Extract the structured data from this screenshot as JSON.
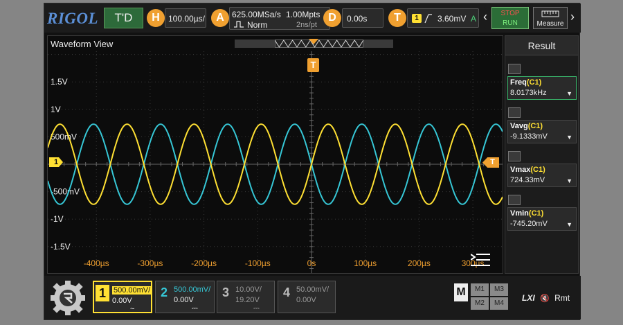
{
  "brand": "RIGOL",
  "topbar": {
    "mode": "T'D",
    "horizontal": {
      "badge": "H",
      "timebase": "100.00µs/"
    },
    "acquire": {
      "badge": "A",
      "sample_rate": "625.00MSa/s",
      "memory_depth": "1.00Mpts",
      "mode": "Norm",
      "resolution": "2ns/pt"
    },
    "delay": {
      "badge": "D",
      "value": "0.00s"
    },
    "trigger": {
      "badge": "T",
      "source": "1",
      "level": "3.60mV",
      "status": "A"
    },
    "stop_run": {
      "line1": "STOP",
      "line2": "RUN"
    },
    "measure": "Measure",
    "prev": "‹",
    "next": "›"
  },
  "waveform_view": {
    "title": "Waveform View",
    "trigger_marker": "T",
    "ch1_marker": "1",
    "trigger_level_marker": "T",
    "menu_icon": "menu-icon",
    "y_labels": [
      "1.5V",
      "1V",
      "500mV",
      "-500mV",
      "-1V",
      "-1.5V"
    ],
    "x_labels": [
      "-400µs",
      "-300µs",
      "-200µs",
      "-100µs",
      "0s",
      "100µs",
      "200µs",
      "300µs"
    ]
  },
  "result_panel": {
    "title": "Result",
    "items": [
      {
        "name": "Freq",
        "source": "(C1)",
        "value": "8.0173kHz",
        "selected": true
      },
      {
        "name": "Vavg",
        "source": "(C1)",
        "value": "-9.1333mV",
        "selected": false
      },
      {
        "name": "Vmax",
        "source": "(C1)",
        "value": "724.33mV",
        "selected": false
      },
      {
        "name": "Vmin",
        "source": "(C1)",
        "value": "-745.20mV",
        "selected": false
      }
    ]
  },
  "channels": [
    {
      "num": "1",
      "scale": "500.00mV/",
      "offset": "0.00V",
      "coupling": "~",
      "color": "#ffe033",
      "active": true
    },
    {
      "num": "2",
      "scale": "500.00mV/",
      "offset": "0.00V",
      "coupling": "⎓",
      "color": "#36c7d6",
      "active": true
    },
    {
      "num": "3",
      "scale": "10.00V/",
      "offset": "19.20V",
      "coupling": "⎓",
      "color": "#999999",
      "active": false
    },
    {
      "num": "4",
      "scale": "50.00mV/",
      "offset": "0.00V",
      "coupling": "",
      "color": "#999999",
      "active": false
    }
  ],
  "math": {
    "label": "M",
    "buttons": [
      "M1",
      "M3",
      "M2",
      "M4"
    ]
  },
  "status_bar": {
    "lxi": "LXI",
    "mute": "🔇",
    "remote": "Rmt"
  },
  "colors": {
    "ch1": "#ffe033",
    "ch2": "#36c7d6",
    "trigger": "#f0a030",
    "grid": "#3a3a3a"
  }
}
